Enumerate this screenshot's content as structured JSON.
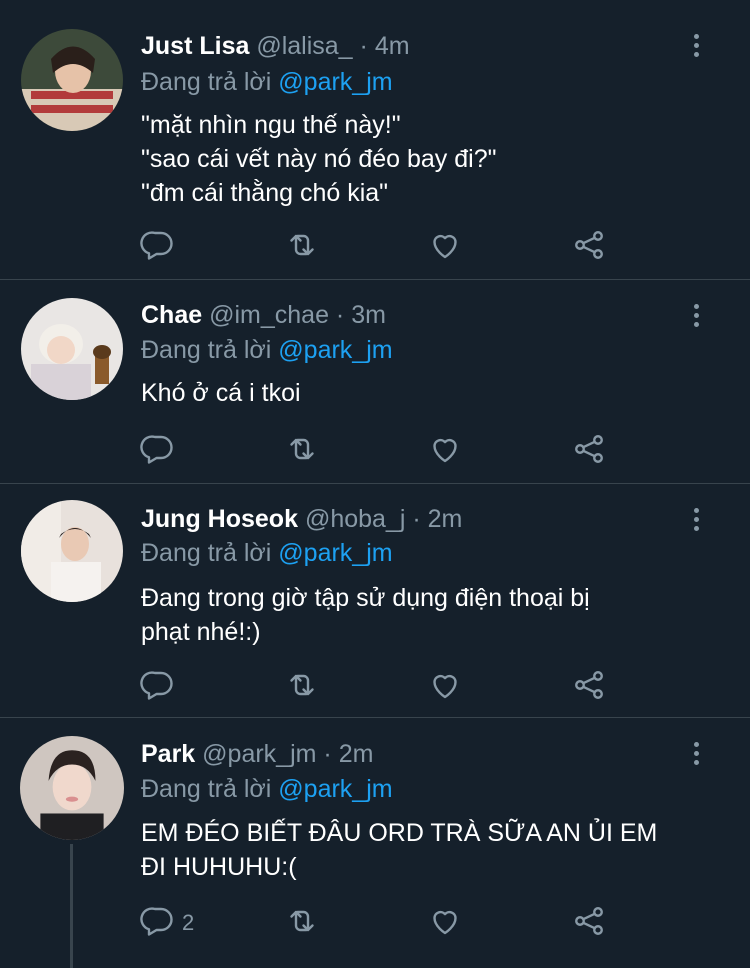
{
  "tweets": [
    {
      "name": "Just Lisa",
      "handle": "@lalisa_",
      "sep": "·",
      "time": "4m",
      "reply_prefix": "Đang trả lời",
      "reply_to": "@park_jm",
      "lines": [
        "\"mặt nhìn ngu thế này!\"",
        "\"sao cái vết này nó đéo bay đi?\"",
        "\"đm cái thằng chó kia\""
      ],
      "reply_count": ""
    },
    {
      "name": "Chae",
      "handle": "@im_chae",
      "sep": "·",
      "time": "3m",
      "reply_prefix": "Đang trả lời",
      "reply_to": "@park_jm",
      "lines": [
        "Khó ở cá i tkoi"
      ],
      "reply_count": ""
    },
    {
      "name": "Jung Hoseok",
      "handle": "@hoba_j",
      "sep": "·",
      "time": "2m",
      "reply_prefix": "Đang trả lời",
      "reply_to": "@park_jm",
      "lines": [
        "Đang trong giờ tập sử dụng điện thoại bị",
        "phạt nhé!:)"
      ],
      "reply_count": ""
    },
    {
      "name": "Park",
      "handle": "@park_jm",
      "sep": "·",
      "time": "2m",
      "reply_prefix": "Đang trả lời",
      "reply_to": "@park_jm",
      "lines": [
        "EM ĐÉO BIẾT ĐÂU ORD TRÀ SỮA AN ỦI EM",
        "ĐI HUHUHU:("
      ],
      "reply_count": "2"
    }
  ],
  "colors": {
    "background": "#15202b",
    "muted": "#8899a6",
    "link": "#1da1f2",
    "divider": "#38444d"
  },
  "icons": [
    "reply-icon",
    "retweet-icon",
    "like-icon",
    "share-icon",
    "more-icon"
  ]
}
